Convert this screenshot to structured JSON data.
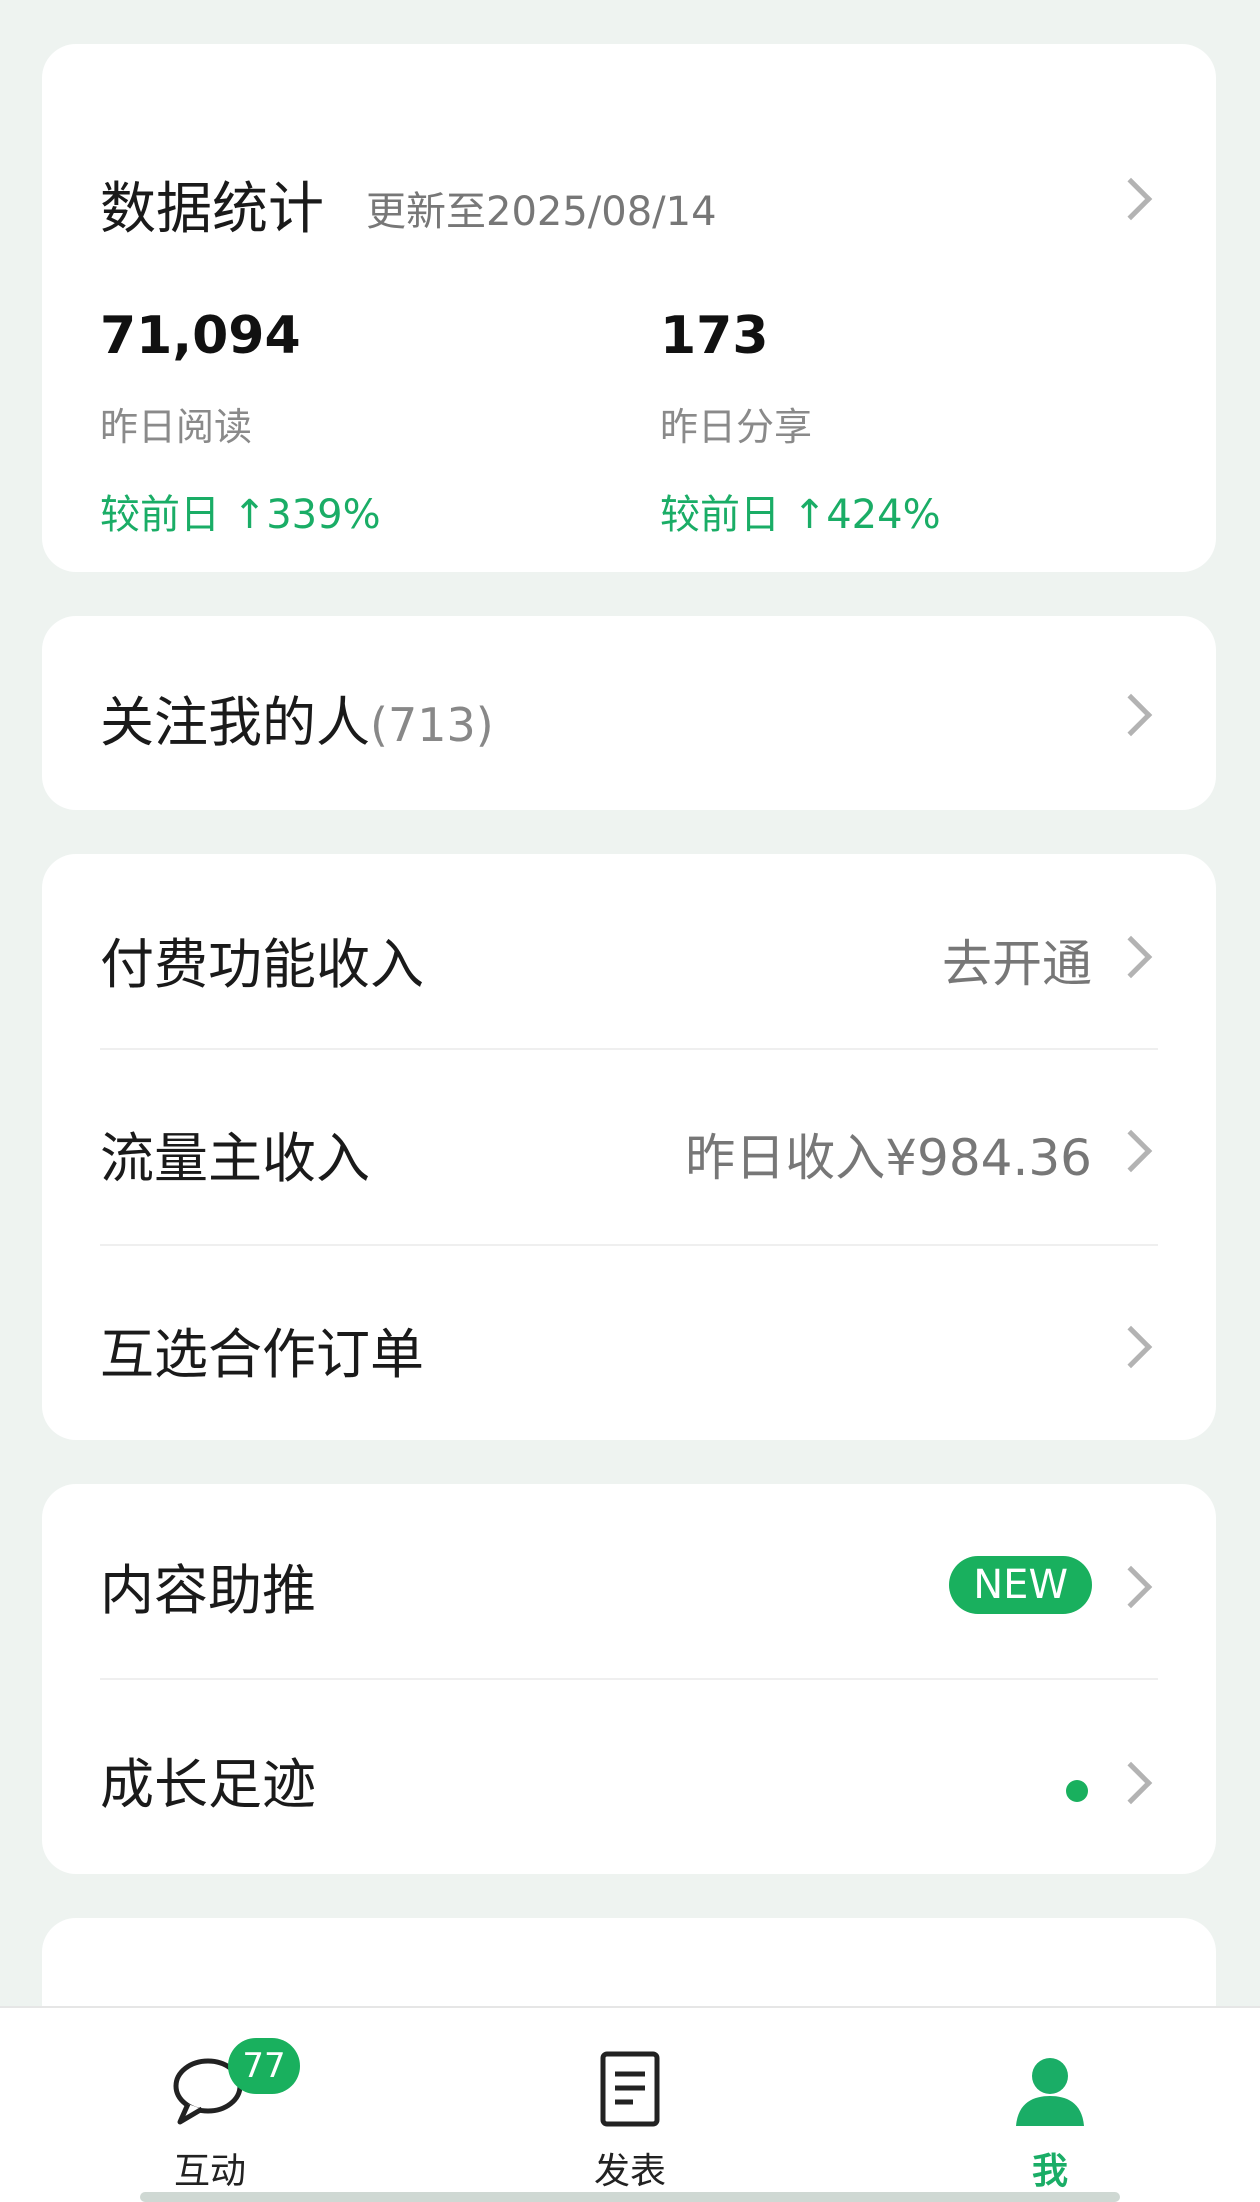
{
  "stats": {
    "title": "数据统计",
    "updated": "更新至2025/08/14",
    "reads": {
      "value": "71,094",
      "label": "昨日阅读",
      "change": "较前日 ↑339%"
    },
    "shares": {
      "value": "173",
      "label": "昨日分享",
      "change": "较前日 ↑424%"
    }
  },
  "followers": {
    "label": "关注我的人",
    "count": "(713)"
  },
  "income": {
    "paid_feature": {
      "label": "付费功能收入",
      "action": "去开通"
    },
    "traffic": {
      "label": "流量主收入",
      "value": "昨日收入¥984.36"
    },
    "orders": {
      "label": "互选合作订单"
    }
  },
  "tools": {
    "promote": {
      "label": "内容助推",
      "badge": "NEW"
    },
    "growth": {
      "label": "成长足迹"
    }
  },
  "tabbar": {
    "interact": {
      "label": "互动",
      "badge": "77"
    },
    "publish": {
      "label": "发表"
    },
    "me": {
      "label": "我"
    }
  },
  "colors": {
    "accent": "#19b05e",
    "background": "#eef3f0"
  }
}
